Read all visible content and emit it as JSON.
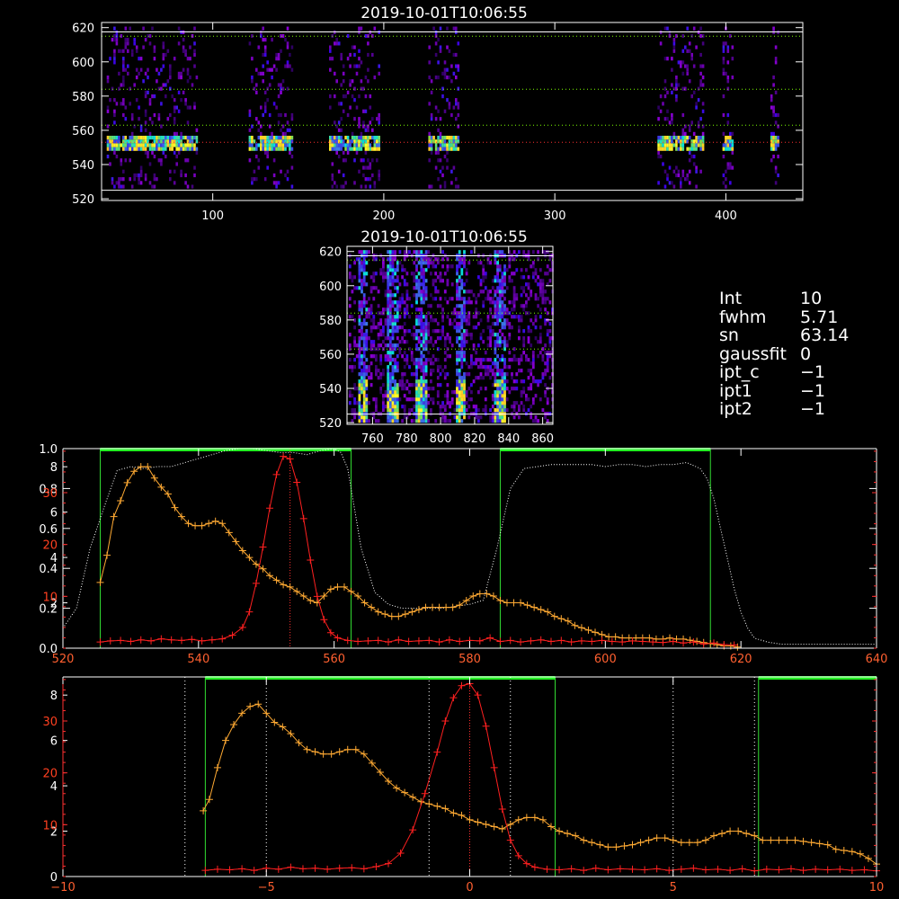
{
  "top_image": {
    "title": "2019-10-01T10:06:55",
    "x_ticks": [
      "100",
      "200",
      "300",
      "400"
    ],
    "x_tick_values": [
      100,
      200,
      300,
      400
    ],
    "x_range": [
      35,
      445
    ],
    "y_ticks": [
      "520",
      "540",
      "560",
      "580",
      "600",
      "620"
    ],
    "y_tick_values": [
      520,
      540,
      560,
      580,
      600,
      620
    ],
    "y_range": [
      519,
      623
    ],
    "h_lines": [
      {
        "y": 617.5,
        "color": "#ffffff",
        "style": "solid"
      },
      {
        "y": 615,
        "color": "#7fff00",
        "style": "dotted"
      },
      {
        "y": 584,
        "color": "#7fff00",
        "style": "dotted"
      },
      {
        "y": 563,
        "color": "#7fff00",
        "style": "dotted"
      },
      {
        "y": 553,
        "color": "#ff3030",
        "style": "dotted"
      },
      {
        "y": 525,
        "color": "#ffffff",
        "style": "solid"
      }
    ],
    "data_columns": [
      [
        38,
        90
      ],
      [
        121,
        147
      ],
      [
        168,
        197
      ],
      [
        226,
        244
      ],
      [
        360,
        387
      ],
      [
        398,
        404
      ],
      [
        426,
        430
      ]
    ],
    "line_y": 551
  },
  "mid_image": {
    "title": "2019-10-01T10:06:55",
    "x_ticks": [
      "760",
      "780",
      "800",
      "820",
      "840",
      "860"
    ],
    "x_tick_values": [
      760,
      780,
      800,
      820,
      840,
      860
    ],
    "x_range": [
      745,
      866
    ],
    "y_ticks": [
      "520",
      "540",
      "560",
      "580",
      "600",
      "620"
    ],
    "y_tick_values": [
      520,
      540,
      560,
      580,
      600,
      620
    ],
    "y_range": [
      519,
      623
    ],
    "h_lines": [
      {
        "y": 617.5,
        "color": "#ffffff",
        "style": "solid"
      },
      {
        "y": 615,
        "color": "#7fff00",
        "style": "dotted"
      },
      {
        "y": 584,
        "color": "#7fff00",
        "style": "dotted"
      },
      {
        "y": 563,
        "color": "#7fff00",
        "style": "dotted"
      },
      {
        "y": 525,
        "color": "#ffffff",
        "style": "solid"
      }
    ],
    "streak_x": [
      754,
      771,
      788,
      811,
      834
    ]
  },
  "info": {
    "rows": [
      {
        "key": "Int",
        "value": "10"
      },
      {
        "key": "fwhm",
        "value": "5.71"
      },
      {
        "key": "sn",
        "value": "63.14"
      },
      {
        "key": "gaussfit",
        "value": "0"
      },
      {
        "key": "ipt_c",
        "value": "−1"
      },
      {
        "key": "ipt1",
        "value": "−1"
      },
      {
        "key": "ipt2",
        "value": "−1"
      }
    ]
  },
  "chart_data": [
    {
      "type": "line",
      "x_ticks": [
        "520",
        "540",
        "560",
        "580",
        "600",
        "620",
        "640"
      ],
      "x_tick_values": [
        520,
        540,
        560,
        580,
        600,
        620,
        640
      ],
      "xlim": [
        520,
        640
      ],
      "y_left_white_ticks": [
        "0.0",
        "0.2",
        "0.4",
        "0.6",
        "0.8",
        "1.0"
      ],
      "y_left_white_values": [
        0,
        0.2,
        0.4,
        0.6,
        0.8,
        1.0
      ],
      "y_left_white_lim": [
        0,
        1.0
      ],
      "y_left_orange_ticks": [
        "2",
        "4",
        "6",
        "8"
      ],
      "y_left_orange_values": [
        2,
        4,
        6,
        8
      ],
      "y_left_orange_lim": [
        0,
        8.8
      ],
      "y_left_red_ticks": [
        "10",
        "20",
        "30"
      ],
      "y_left_red_values": [
        10,
        20,
        30
      ],
      "y_left_red_lim": [
        0,
        38.5
      ],
      "green_boxes": [
        [
          525.5,
          562.5
        ],
        [
          584.5,
          615.5
        ]
      ],
      "red_marker_x": 553.5,
      "series": [
        {
          "color": "#ffffff",
          "style": "dotted",
          "x": [
            520,
            522,
            524,
            526,
            528,
            530,
            532,
            534,
            536,
            538,
            540,
            542,
            544,
            546,
            548,
            550,
            552,
            554,
            556,
            558,
            560,
            561,
            562,
            563,
            564,
            566,
            568,
            570,
            572,
            574,
            576,
            578,
            580,
            582,
            584,
            586,
            588,
            590,
            592,
            594,
            596,
            598,
            600,
            602,
            604,
            606,
            608,
            610,
            612,
            614,
            615,
            616,
            617,
            618,
            619,
            620,
            621,
            622,
            624,
            626,
            630,
            635,
            640
          ],
          "y": [
            0.1,
            0.2,
            0.5,
            0.7,
            0.89,
            0.91,
            0.9,
            0.91,
            0.91,
            0.93,
            0.95,
            0.97,
            0.99,
            1.0,
            1.0,
            0.99,
            0.98,
            0.98,
            0.97,
            0.99,
            1.0,
            0.98,
            0.9,
            0.7,
            0.5,
            0.28,
            0.22,
            0.2,
            0.2,
            0.2,
            0.2,
            0.21,
            0.22,
            0.24,
            0.5,
            0.8,
            0.9,
            0.91,
            0.92,
            0.92,
            0.92,
            0.92,
            0.91,
            0.92,
            0.92,
            0.91,
            0.92,
            0.92,
            0.93,
            0.9,
            0.85,
            0.75,
            0.6,
            0.45,
            0.3,
            0.18,
            0.1,
            0.05,
            0.03,
            0.02,
            0.02,
            0.02,
            0.02
          ]
        },
        {
          "color": "#ffaa33",
          "style": "solid",
          "x": [
            525.5,
            526.5,
            527.5,
            528.5,
            529.5,
            530.5,
            531.5,
            532.5,
            533.5,
            534.5,
            535.5,
            536.5,
            537.5,
            538.5,
            539.5,
            540.5,
            541.5,
            542.5,
            543.5,
            544.5,
            545.5,
            546.5,
            547.5,
            548.5,
            549.5,
            550.5,
            551.5,
            552.5,
            553.5,
            554.5,
            555.5,
            556.5,
            557.5,
            558.5,
            559.5,
            560.5,
            561.5,
            562.5,
            563.5,
            564.5,
            565.5,
            566.5,
            567.5,
            568.5,
            569.5,
            570.5,
            571.5,
            572.5,
            573.5,
            574.5,
            575.5,
            576.5,
            577.5,
            578.5,
            579.5,
            580.5,
            581.5,
            582.5,
            583.5,
            584.5,
            585.5,
            586.5,
            587.5,
            588.5,
            589.5,
            590.5,
            591.5,
            592.5,
            593.5,
            594.5,
            595.5,
            596.5,
            597.5,
            598.5,
            599.5,
            600.5,
            601.5,
            602.5,
            603.5,
            604.5,
            605.5,
            606.5,
            607.5,
            608.5,
            609.5,
            610.5,
            611.5,
            612.5,
            613.5,
            614.5,
            615.5,
            616.5,
            617.5,
            618.5,
            619.5
          ],
          "y": [
            2.9,
            4.1,
            5.8,
            6.5,
            7.3,
            7.8,
            8.0,
            8.0,
            7.5,
            7.1,
            6.8,
            6.2,
            5.8,
            5.5,
            5.4,
            5.4,
            5.5,
            5.6,
            5.5,
            5.1,
            4.7,
            4.3,
            4.0,
            3.7,
            3.5,
            3.2,
            3.0,
            2.8,
            2.7,
            2.5,
            2.3,
            2.1,
            2.0,
            2.3,
            2.6,
            2.7,
            2.7,
            2.5,
            2.3,
            2.0,
            1.8,
            1.6,
            1.5,
            1.4,
            1.4,
            1.5,
            1.6,
            1.7,
            1.8,
            1.8,
            1.8,
            1.8,
            1.8,
            1.9,
            2.1,
            2.3,
            2.4,
            2.4,
            2.3,
            2.1,
            2.0,
            2.0,
            2.0,
            1.9,
            1.8,
            1.7,
            1.6,
            1.4,
            1.3,
            1.2,
            1.0,
            0.9,
            0.8,
            0.7,
            0.6,
            0.5,
            0.5,
            0.45,
            0.45,
            0.45,
            0.45,
            0.45,
            0.4,
            0.4,
            0.45,
            0.4,
            0.4,
            0.35,
            0.3,
            0.25,
            0.2,
            0.15,
            0.1,
            0.1,
            0.05
          ]
        },
        {
          "color": "#ff2020",
          "style": "solid",
          "x": [
            525.5,
            527,
            528.5,
            530,
            531.5,
            533,
            534.5,
            536,
            537.5,
            539,
            540.5,
            542,
            543.5,
            545,
            546.5,
            547.5,
            548.5,
            549.5,
            550.5,
            551.5,
            552.5,
            553.5,
            554.5,
            555.5,
            556.5,
            557.5,
            558.5,
            559.5,
            560.5,
            562,
            563.5,
            565,
            566.5,
            568,
            569.5,
            571,
            572.5,
            574,
            575.5,
            577,
            578.5,
            580,
            581.5,
            583,
            584.5,
            586,
            587.5,
            589,
            590.5,
            592,
            593.5,
            595,
            596.5,
            598,
            599.5,
            601,
            602.5,
            604,
            605.5,
            607,
            608.5,
            610,
            611.5,
            613,
            614.5,
            616,
            617.5,
            619
          ],
          "y": [
            1.2,
            1.4,
            1.5,
            1.3,
            1.6,
            1.4,
            1.8,
            1.6,
            1.5,
            1.7,
            1.4,
            1.6,
            1.8,
            2.5,
            4.0,
            7.0,
            12.5,
            19.5,
            27.0,
            33.5,
            37.0,
            36.5,
            32.0,
            25.0,
            17.0,
            10.0,
            5.5,
            3.0,
            2.0,
            1.5,
            1.3,
            1.4,
            1.5,
            1.2,
            1.6,
            1.3,
            1.4,
            1.5,
            1.2,
            1.6,
            1.3,
            1.5,
            1.4,
            2.0,
            1.3,
            1.5,
            1.2,
            1.4,
            1.6,
            1.3,
            1.5,
            1.2,
            1.4,
            1.3,
            1.5,
            1.3,
            1.2,
            1.4,
            1.3,
            1.2,
            1.1,
            1.3,
            1.0,
            1.2,
            0.8,
            1.0,
            0.7,
            0.6
          ]
        }
      ]
    },
    {
      "type": "line",
      "x_ticks": [
        "−10",
        "−5",
        "0",
        "5",
        "10"
      ],
      "x_tick_values": [
        -10,
        -5,
        0,
        5,
        10
      ],
      "xlim": [
        -10,
        10
      ],
      "y_left_orange_ticks": [
        "0",
        "2",
        "4",
        "6",
        "8"
      ],
      "y_left_orange_values": [
        0,
        2,
        4,
        6,
        8
      ],
      "y_left_orange_lim": [
        0,
        8.8
      ],
      "y_left_red_ticks": [
        "10",
        "20",
        "30"
      ],
      "y_left_red_values": [
        10,
        20,
        30
      ],
      "y_left_red_lim": [
        0,
        38.5
      ],
      "green_boxes": [
        [
          -6.5,
          2.1
        ],
        [
          7.1,
          10
        ]
      ],
      "red_marker_x": 0,
      "white_dotted_x": [
        -7,
        -5,
        -1,
        1,
        5,
        7
      ],
      "series": [
        {
          "color": "#ffaa33",
          "style": "solid",
          "x": [
            -6.55,
            -6.4,
            -6.2,
            -6.0,
            -5.8,
            -5.6,
            -5.4,
            -5.2,
            -5.0,
            -4.8,
            -4.6,
            -4.4,
            -4.2,
            -4.0,
            -3.8,
            -3.6,
            -3.4,
            -3.2,
            -3.0,
            -2.8,
            -2.6,
            -2.4,
            -2.2,
            -2.0,
            -1.8,
            -1.6,
            -1.4,
            -1.2,
            -1.0,
            -0.8,
            -0.6,
            -0.4,
            -0.2,
            0.0,
            0.2,
            0.4,
            0.6,
            0.8,
            1.0,
            1.2,
            1.4,
            1.6,
            1.8,
            2.0,
            2.2,
            2.4,
            2.6,
            2.8,
            3.0,
            3.2,
            3.4,
            3.6,
            3.8,
            4.0,
            4.2,
            4.4,
            4.6,
            4.8,
            5.0,
            5.2,
            5.4,
            5.6,
            5.8,
            6.0,
            6.2,
            6.4,
            6.6,
            6.8,
            7.0,
            7.2,
            7.4,
            7.6,
            7.8,
            8.0,
            8.2,
            8.4,
            8.6,
            8.8,
            9.0,
            9.2,
            9.4,
            9.6,
            9.8,
            10.0
          ],
          "y": [
            2.9,
            3.4,
            4.8,
            6.0,
            6.7,
            7.2,
            7.5,
            7.6,
            7.2,
            6.8,
            6.6,
            6.3,
            5.9,
            5.6,
            5.5,
            5.4,
            5.4,
            5.5,
            5.6,
            5.6,
            5.4,
            5.0,
            4.6,
            4.2,
            3.9,
            3.7,
            3.5,
            3.3,
            3.2,
            3.1,
            3.0,
            2.8,
            2.7,
            2.5,
            2.4,
            2.3,
            2.2,
            2.1,
            2.3,
            2.5,
            2.6,
            2.6,
            2.5,
            2.2,
            2.0,
            1.9,
            1.8,
            1.6,
            1.5,
            1.4,
            1.3,
            1.3,
            1.35,
            1.4,
            1.5,
            1.6,
            1.7,
            1.7,
            1.6,
            1.5,
            1.5,
            1.5,
            1.6,
            1.8,
            1.9,
            2.0,
            2.0,
            1.9,
            1.8,
            1.6,
            1.6,
            1.6,
            1.6,
            1.6,
            1.55,
            1.5,
            1.45,
            1.4,
            1.2,
            1.15,
            1.1,
            1.0,
            0.8,
            0.55
          ]
        },
        {
          "color": "#ff2020",
          "style": "solid",
          "x": [
            -6.5,
            -6.2,
            -5.9,
            -5.6,
            -5.3,
            -5.0,
            -4.7,
            -4.4,
            -4.1,
            -3.8,
            -3.5,
            -3.2,
            -2.9,
            -2.6,
            -2.3,
            -2.0,
            -1.7,
            -1.4,
            -1.1,
            -0.8,
            -0.6,
            -0.4,
            -0.2,
            0.0,
            0.2,
            0.4,
            0.6,
            0.8,
            1.0,
            1.2,
            1.4,
            1.6,
            1.9,
            2.2,
            2.5,
            2.8,
            3.1,
            3.4,
            3.7,
            4.0,
            4.3,
            4.6,
            4.9,
            5.2,
            5.5,
            5.8,
            6.1,
            6.4,
            6.7,
            7.0,
            7.3,
            7.6,
            7.9,
            8.2,
            8.5,
            8.8,
            9.1,
            9.4,
            9.7,
            10.0
          ],
          "y": [
            1.2,
            1.4,
            1.3,
            1.5,
            1.2,
            1.6,
            1.4,
            1.8,
            1.5,
            1.6,
            1.4,
            1.6,
            1.7,
            1.5,
            1.9,
            2.5,
            4.5,
            9.0,
            16.0,
            24.0,
            30.0,
            34.5,
            36.8,
            37.2,
            35.0,
            29.0,
            21.0,
            13.0,
            7.0,
            4.0,
            2.5,
            1.8,
            1.4,
            1.3,
            1.5,
            1.2,
            1.6,
            1.3,
            1.5,
            1.4,
            1.3,
            1.5,
            1.2,
            1.4,
            1.6,
            1.3,
            1.4,
            1.2,
            1.5,
            1.1,
            1.4,
            1.3,
            1.5,
            1.2,
            1.4,
            1.3,
            1.4,
            1.2,
            1.3,
            1.1
          ]
        }
      ]
    }
  ]
}
